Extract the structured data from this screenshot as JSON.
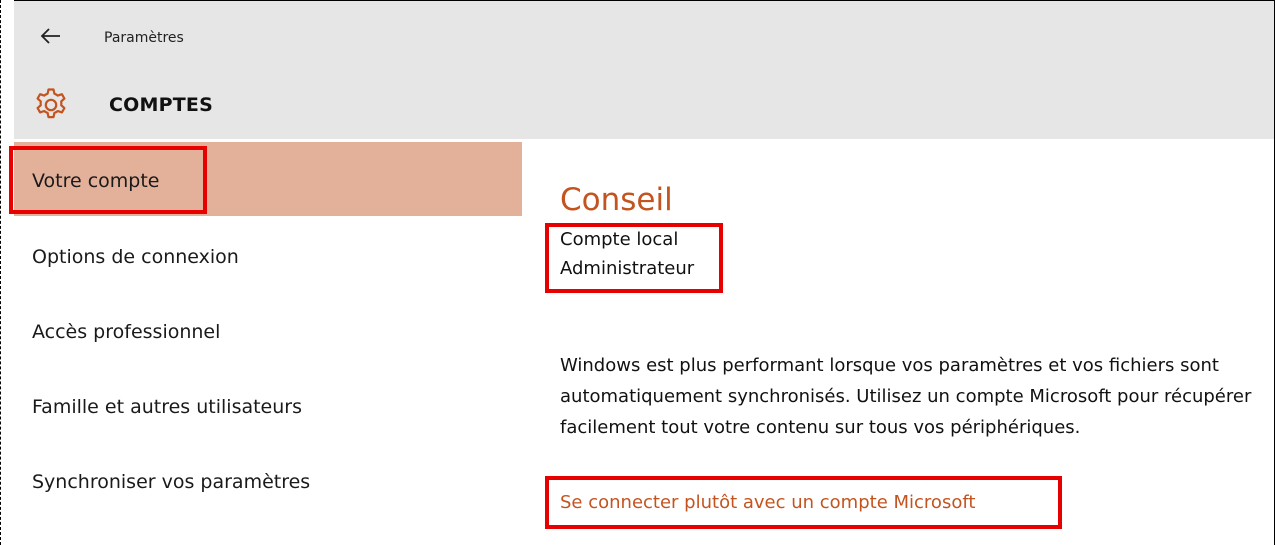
{
  "header": {
    "app_title": "Paramètres",
    "page_title": "COMPTES",
    "back_icon": "back-arrow-icon",
    "section_icon": "gear-icon",
    "accent_color": "#c4541f"
  },
  "sidebar": {
    "items": [
      {
        "label": "Votre compte",
        "active": true
      },
      {
        "label": "Options de connexion",
        "active": false
      },
      {
        "label": "Accès professionnel",
        "active": false
      },
      {
        "label": "Famille et autres utilisateurs",
        "active": false
      },
      {
        "label": "Synchroniser vos paramètres",
        "active": false
      }
    ],
    "active_color": "#e3b09a"
  },
  "content": {
    "section_title": "Conseil",
    "account_type": "Compte local",
    "account_role": "Administrateur",
    "description": "Windows est plus performant lorsque vos paramètres et vos fichiers sont automatiquement synchronisés. Utilisez un compte Microsoft pour récupérer facilement tout votre contenu sur tous vos périphériques.",
    "link_label": "Se connecter plutôt avec un compte Microsoft"
  },
  "annotations": {
    "highlight_color": "#e60000"
  }
}
